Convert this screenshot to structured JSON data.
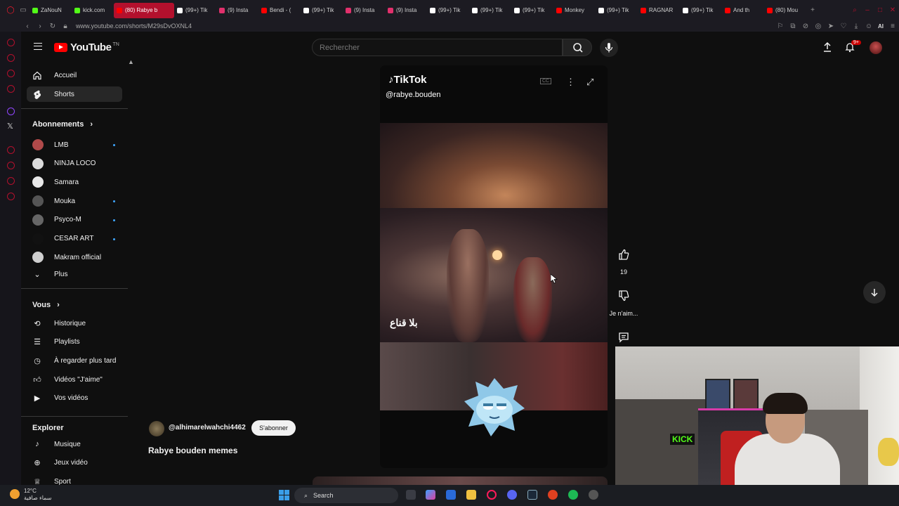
{
  "browser": {
    "tabs": [
      {
        "label": "ZaNouN",
        "color": "#53fc18"
      },
      {
        "label": "kick.com",
        "color": "#53fc18"
      },
      {
        "label": "(80) Rabye b",
        "color": "#ff0000",
        "active": true
      },
      {
        "label": "(99+) Tik",
        "color": "#ffffff"
      },
      {
        "label": "(9) Insta",
        "color": "#e1306c"
      },
      {
        "label": "Bendi - (",
        "color": "#ff0000"
      },
      {
        "label": "(99+) Tik",
        "color": "#ffffff"
      },
      {
        "label": "(9) Insta",
        "color": "#e1306c"
      },
      {
        "label": "(9) Insta",
        "color": "#e1306c"
      },
      {
        "label": "(99+) Tik",
        "color": "#ffffff"
      },
      {
        "label": "(99+) Tik",
        "color": "#ffffff"
      },
      {
        "label": "(99+) Tik",
        "color": "#ffffff"
      },
      {
        "label": "Monkey",
        "color": "#ff0000"
      },
      {
        "label": "(99+) Tik",
        "color": "#ffffff"
      },
      {
        "label": "RAGNAR",
        "color": "#ff0000"
      },
      {
        "label": "(99+) Tik",
        "color": "#ffffff"
      },
      {
        "label": "And th",
        "color": "#ff0000"
      },
      {
        "label": "(80) Mou",
        "color": "#ff0000"
      }
    ],
    "url": "www.youtube.com/shorts/M29sDvOXNL4",
    "ai_label": "AI"
  },
  "header": {
    "logo_text": "YouTube",
    "country": "TN",
    "search_placeholder": "Rechercher",
    "notifications_badge": "9+"
  },
  "sidebar": {
    "home": "Accueil",
    "shorts": "Shorts",
    "subscriptions_heading": "Abonnements",
    "subscriptions": [
      {
        "name": "LMB",
        "dot": true,
        "color": "#b04a4a"
      },
      {
        "name": "NINJA LOCO",
        "dot": false,
        "color": "#dcdcdc"
      },
      {
        "name": "Samara",
        "dot": false,
        "color": "#e8e8e8"
      },
      {
        "name": "Mouka",
        "dot": true,
        "color": "#555555"
      },
      {
        "name": "Psyco-M",
        "dot": true,
        "color": "#666666"
      },
      {
        "name": "CESAR ART",
        "dot": true,
        "color": "#111111"
      },
      {
        "name": "Makram official",
        "dot": false,
        "color": "#cfcfcf"
      }
    ],
    "more": "Plus",
    "you_heading": "Vous",
    "you_items": [
      {
        "label": "Historique",
        "icon": "history-icon"
      },
      {
        "label": "Playlists",
        "icon": "playlist-icon"
      },
      {
        "label": "À regarder plus tard",
        "icon": "clock-icon"
      },
      {
        "label": "Vidéos \"J'aime\"",
        "icon": "thumb-up-icon"
      },
      {
        "label": "Vos vidéos",
        "icon": "video-icon"
      }
    ],
    "explore_heading": "Explorer",
    "explore_items": [
      {
        "label": "Musique",
        "icon": "music-icon"
      },
      {
        "label": "Jeux vidéo",
        "icon": "gamepad-icon"
      },
      {
        "label": "Sport",
        "icon": "trophy-icon"
      }
    ]
  },
  "video": {
    "overlay_logo": "TikTok",
    "overlay_user": "@rabye.bouden",
    "caption": "بلا قناع",
    "likes": "19",
    "dislike_label": "Je n'aim..."
  },
  "channel": {
    "handle": "@alhimarelwahchi4462",
    "subscribe": "S'abonner",
    "title": "Rabye bouden memes"
  },
  "taskbar": {
    "temperature": "12°C",
    "weather_desc": "سماء صافية",
    "search_label": "Search"
  }
}
